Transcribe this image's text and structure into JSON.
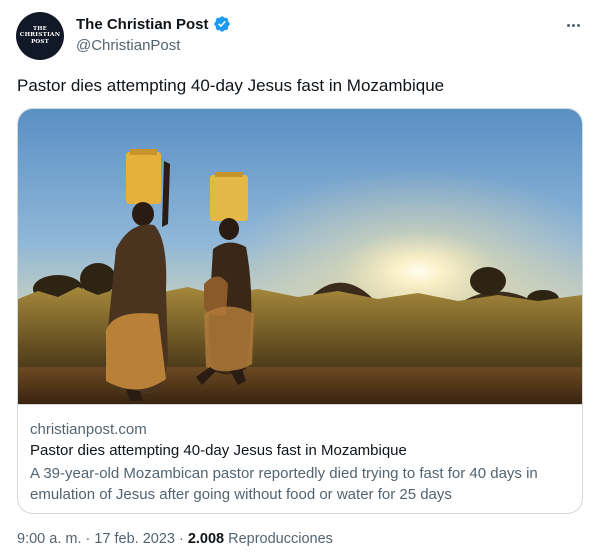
{
  "author": {
    "display_name": "The Christian Post",
    "handle": "@ChristianPost",
    "avatar_text": [
      "THE",
      "CHRISTIAN",
      "POST"
    ],
    "verified_color": "#1d9bf0"
  },
  "tweet": {
    "text": "Pastor dies attempting 40-day Jesus fast in Mozambique"
  },
  "card": {
    "domain": "christianpost.com",
    "title": "Pastor dies attempting 40-day Jesus fast in Mozambique",
    "description": "A 39-year-old Mozambican pastor reportedly died trying to fast for 40 days in emulation of Jesus after going without food or water for 25 days"
  },
  "meta": {
    "time": "9:00 a. m.",
    "separator": "·",
    "date": "17 feb. 2023",
    "views_count": "2.008",
    "views_label": "Reproducciones"
  },
  "icons": {
    "more": "more-horizontal-icon",
    "verified": "verified-badge-icon"
  },
  "colors": {
    "text_primary": "#0f1419",
    "text_secondary": "#536471",
    "border": "#cfd9de"
  }
}
